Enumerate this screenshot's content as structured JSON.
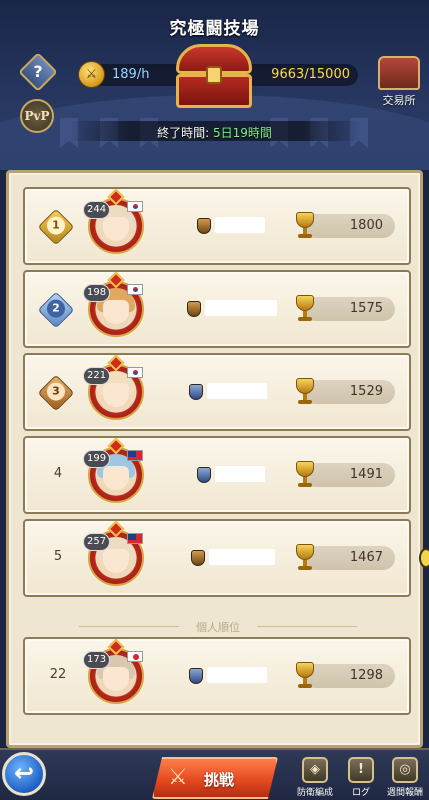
{
  "header": {
    "title": "究極闘技場",
    "rate": "189/h",
    "points": "9663/15000",
    "shop_label": "交易所",
    "pvp_label": "PvP",
    "end_time_label": "終了時間: ",
    "end_time_value": "5日19時間"
  },
  "ranking": [
    {
      "rank": "1",
      "level": "244",
      "flag": "KR",
      "score": "1800"
    },
    {
      "rank": "2",
      "level": "198",
      "flag": "KR",
      "score": "1575"
    },
    {
      "rank": "3",
      "level": "221",
      "flag": "KR",
      "score": "1529"
    },
    {
      "rank": "4",
      "level": "199",
      "flag": "TW",
      "score": "1491"
    },
    {
      "rank": "5",
      "level": "257",
      "flag": "TW",
      "score": "1467"
    }
  ],
  "personal_rank_label": "個人順位",
  "personal": {
    "rank": "22",
    "level": "173",
    "flag": "JP",
    "score": "1298"
  },
  "footer": {
    "challenge_label": "挑戦",
    "defense_label": "防衛編成",
    "log_label": "ログ",
    "weekly_label": "週間報酬"
  },
  "colors": {
    "accent": "#e2461e",
    "rate_text": "#9fd2ff",
    "points_text": "#ffd94a",
    "time_text": "#7ef08a"
  }
}
